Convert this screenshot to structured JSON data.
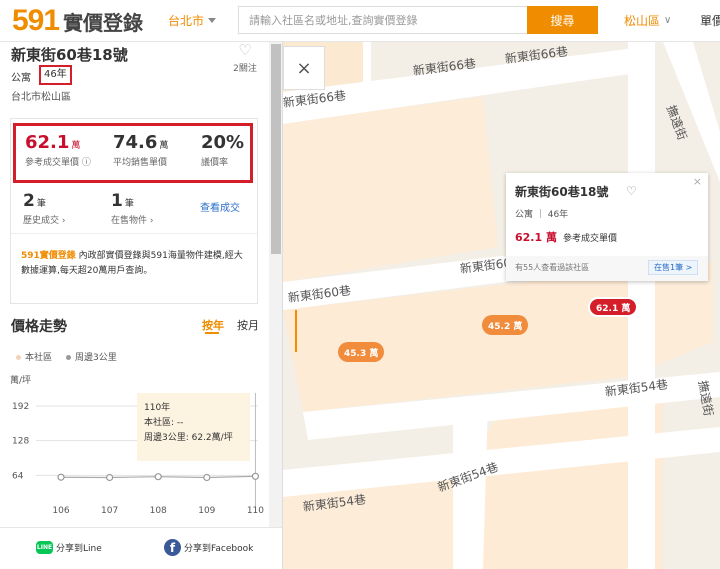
{
  "header": {
    "logo_num": "591",
    "logo_text": "實價登錄",
    "city": "台北市",
    "search_placeholder": "請輸入社區名或地址,查詢實價登錄",
    "search_button": "搜尋",
    "district": "松山區",
    "more": "單價"
  },
  "listing": {
    "address": "新東街60巷18號",
    "favorites": "2關注",
    "property_type": "公寓",
    "age": "46年",
    "area": "台北市松山區"
  },
  "stats": {
    "ref_price": "62.1",
    "ref_price_unit": "萬",
    "ref_price_label": "參考成交單價 ⓘ",
    "avg_sale": "74.6",
    "avg_sale_unit": "萬",
    "avg_sale_label": "平均銷售單價",
    "discount": "20%",
    "discount_label": "議價率",
    "history_count": "2",
    "history_unit": "筆",
    "history_label": "歷史成交 ›",
    "for_sale_count": "1",
    "for_sale_unit": "筆",
    "for_sale_label": "在售物件 ›",
    "view_link": "查看成交"
  },
  "intro": {
    "brand": "591實價登錄",
    "text": " 內政部實價登錄與591海量物件建模,經大數據運算,每天超20萬用戶查詢。"
  },
  "trend": {
    "title": "價格走勢",
    "tab_year": "按年",
    "tab_month": "按月",
    "legend_community": "本社區",
    "legend_nearby": "周邊3公里"
  },
  "chart_data": {
    "type": "line",
    "ylabel": "萬/坪",
    "yticks": [
      192,
      128,
      64
    ],
    "ylim": [
      0,
      192
    ],
    "categories": [
      "106",
      "107",
      "108",
      "109",
      "110"
    ],
    "series": [
      {
        "name": "本社區",
        "values": [
          null,
          null,
          null,
          null,
          null
        ],
        "color": "#f5d2b8"
      },
      {
        "name": "周邊3公里",
        "values": [
          60.5,
          60.0,
          61.5,
          60.0,
          62.2
        ],
        "color": "#999999"
      }
    ],
    "tooltip": {
      "year": "110年",
      "community": "本社區: --",
      "nearby": "周邊3公里: 62.2萬/坪"
    }
  },
  "footer": {
    "line_icon": "LINE",
    "share_line": "分享到Line",
    "fb_icon": "f",
    "share_fb": "分享到Facebook"
  },
  "map": {
    "close": "×",
    "streets": [
      "新東街66巷",
      "新東街66巷",
      "新東街66巷",
      "撫遠街",
      "新東街60巷",
      "新東街60巷",
      "新東街54巷",
      "新東街54巷",
      "新東街54巷",
      "撫遠街"
    ],
    "pins": [
      "45.3 萬",
      "45.2 萬",
      "62.1 萬"
    ]
  },
  "popup": {
    "title": "新東街60巷18號",
    "sub": "公寓 ｜ 46年",
    "price": "62.1 萬",
    "price_label": "參考成交單價",
    "views": "有55人查看過該社區",
    "sale": "在售1筆 >",
    "close": "×"
  },
  "colors": {
    "accent": "#f08c00",
    "highlight": "#d41f2a",
    "link": "#2a6fc9"
  }
}
